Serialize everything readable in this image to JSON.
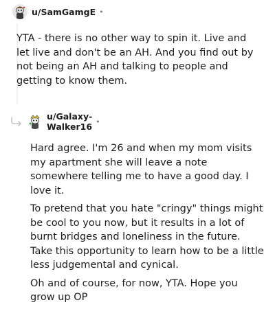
{
  "comments": [
    {
      "username": "u/SamGamgE",
      "separator": "•",
      "avatar": "snoo-avatar-icon",
      "paragraphs": [
        "YTA - there is no other way to spin it. Live and let live and don't be an AH. And you find out by not being an AH and talking to people and getting to know them."
      ]
    },
    {
      "username": "u/Galaxy-Walker16",
      "separator": "•",
      "avatar": "snoo-avatar-icon",
      "reply_icon": "reply-arrow-icon",
      "paragraphs": [
        "Hard agree. I'm 26 and when my mom visits my apartment she will leave a note somewhere telling me to have a good day. I love it.",
        "To pretend that you hate \"cringy\" things might be cool to you now, but it results in a lot of burnt bridges and loneliness in the future. Take this opportunity to learn how to be a little less judgemental and cynical.",
        "Oh and of course, for now, YTA. Hope you grow up OP"
      ]
    }
  ],
  "colors": {
    "text": "#1c1c1c",
    "meta": "#7c7c7c",
    "thread_line": "#edeff1"
  }
}
